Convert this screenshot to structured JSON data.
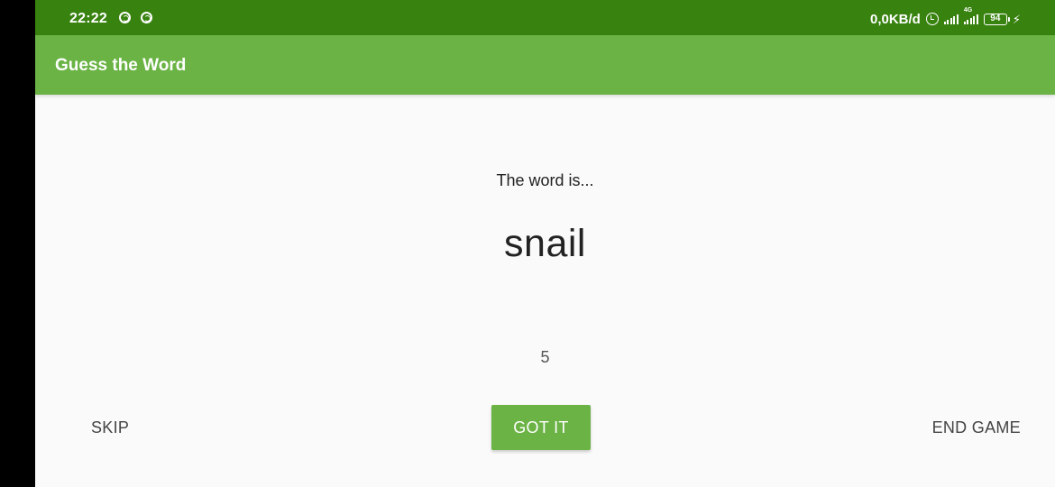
{
  "status_bar": {
    "time": "22:22",
    "network_speed": "0,0KB/d",
    "network_type": "4G",
    "battery": "94",
    "color": "#38820f"
  },
  "app_bar": {
    "title": "Guess the Word",
    "color": "#6ab344"
  },
  "game": {
    "prompt": "The word is...",
    "word": "snail",
    "score": "5"
  },
  "actions": {
    "skip_label": "SKIP",
    "got_it_label": "GOT IT",
    "end_game_label": "END GAME"
  }
}
